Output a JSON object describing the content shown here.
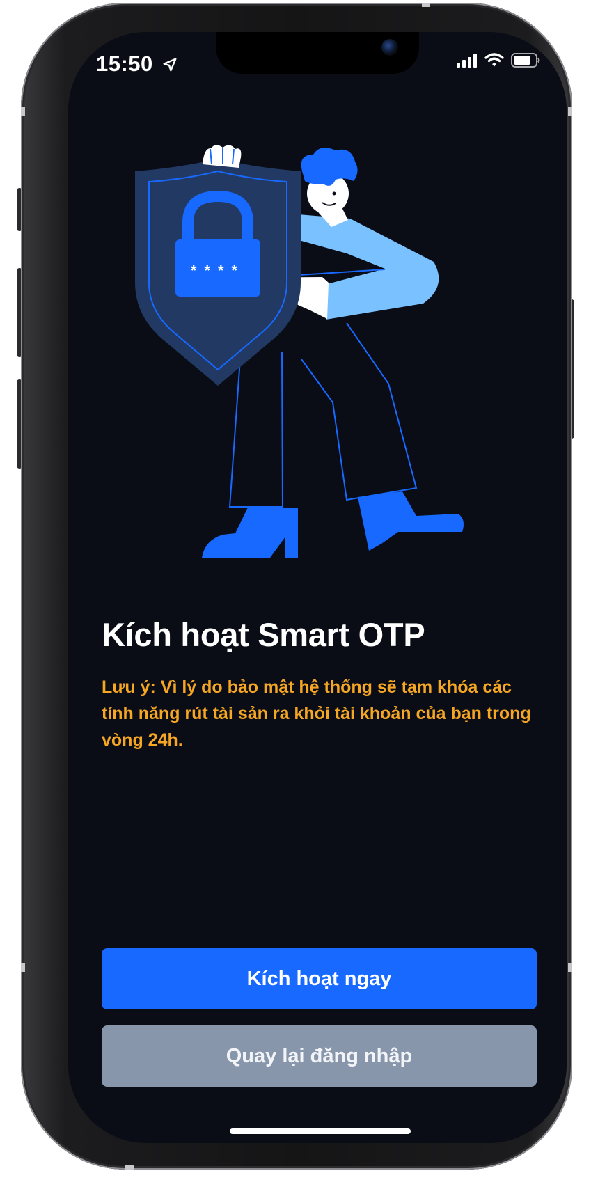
{
  "status_bar": {
    "time": "15:50",
    "icons": [
      "location-arrow-icon",
      "cellular-signal-icon",
      "wifi-icon",
      "battery-icon"
    ]
  },
  "illustration": {
    "pin_mask": "****",
    "icons": [
      "shield-icon",
      "padlock-icon"
    ]
  },
  "main": {
    "title": "Kích hoạt Smart OTP",
    "note": "Lưu ý: Vì lý do bảo mật hệ thống sẽ tạm khóa các tính năng rút tài sản ra khỏi tài khoản của bạn trong vòng 24h."
  },
  "actions": {
    "activate_label": "Kích hoạt ngay",
    "back_label": "Quay lại đăng nhập"
  },
  "colors": {
    "background": "#0a0d16",
    "primary": "#1769ff",
    "secondary": "#8896ab",
    "warning_text": "#f5a623",
    "illustration_light_blue": "#79c1ff"
  }
}
